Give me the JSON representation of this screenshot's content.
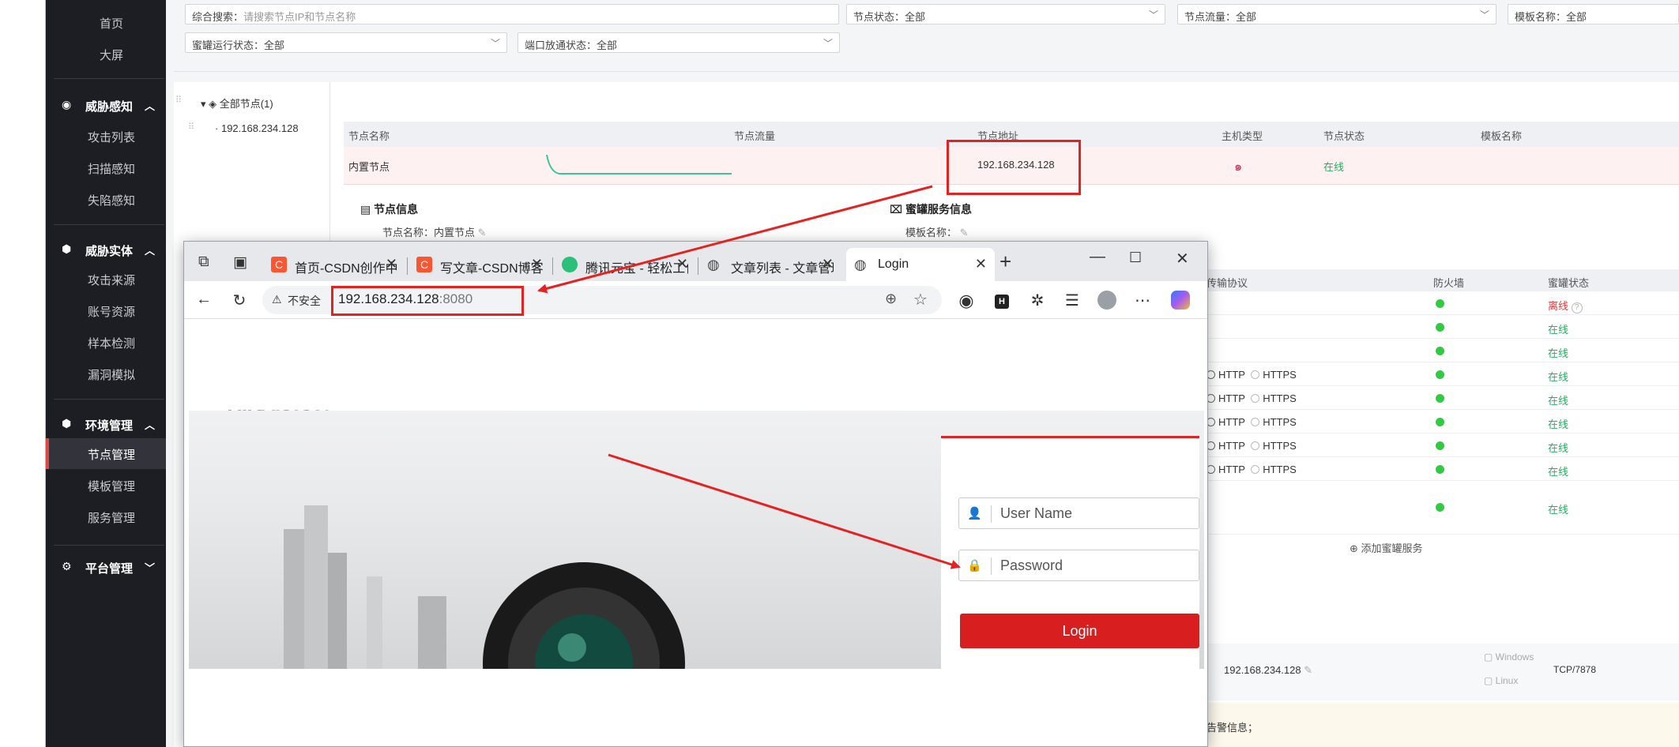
{
  "sidebar": {
    "top_items": [
      "首页",
      "大屏"
    ],
    "groups": [
      {
        "title": "威胁感知",
        "items": [
          "攻击列表",
          "扫描感知",
          "失陷感知"
        ]
      },
      {
        "title": "威胁实体",
        "items": [
          "攻击来源",
          "账号资源",
          "样本检测",
          "漏洞模拟"
        ]
      },
      {
        "title": "环境管理",
        "items": [
          "节点管理",
          "模板管理",
          "服务管理"
        ]
      },
      {
        "title": "平台管理",
        "items": []
      }
    ],
    "active_item": "节点管理"
  },
  "filters": {
    "search_label": "综合搜索：",
    "search_placeholder": "请搜索节点IP和节点名称",
    "node_status": "节点状态：全部",
    "node_traffic": "节点流量：全部",
    "template_name": "模板名称：全部",
    "honeypot_status": "蜜罐运行状态：全部",
    "port_status": "端口放通状态：全部"
  },
  "tree": {
    "root": "全部节点(1)",
    "child": "192.168.234.128"
  },
  "node_table": {
    "headers": [
      "节点名称",
      "节点流量",
      "节点地址",
      "主机类型",
      "节点状态",
      "模板名称"
    ],
    "row": {
      "name": "内置节点",
      "address": "192.168.234.128",
      "status": "在线"
    }
  },
  "node_info": {
    "title": "节点信息",
    "name_label": "节点名称：内置节点",
    "service_title": "蜜罐服务信息",
    "template_label": "模板名称："
  },
  "service_table": {
    "headers": [
      "传输协议",
      "防火墙",
      "蜜罐状态"
    ],
    "rows": [
      {
        "proto": false,
        "status": "离线",
        "help": "?"
      },
      {
        "proto": false,
        "status": "在线"
      },
      {
        "proto": false,
        "status": "在线"
      },
      {
        "proto": true,
        "status": "在线"
      },
      {
        "proto": true,
        "status": "在线"
      },
      {
        "proto": true,
        "status": "在线"
      },
      {
        "proto": true,
        "status": "在线"
      },
      {
        "proto": true,
        "status": "在线"
      },
      {
        "proto": false,
        "status": "在线"
      }
    ],
    "http": "HTTP",
    "https": "HTTPS",
    "add_service": "添加蜜罐服务"
  },
  "bottom_info": {
    "ip": "192.168.234.128",
    "os_windows": "Windows",
    "os_linux": "Linux",
    "port": "TCP/7878",
    "alert": "告警信息；"
  },
  "browser": {
    "tabs": [
      {
        "title": "首页-CSDN创作中心",
        "favicon": "csdn-icon",
        "color": "#fc5531"
      },
      {
        "title": "写文章-CSDN博客",
        "favicon": "csdn-icon",
        "color": "#fc5531"
      },
      {
        "title": "腾讯元宝 - 轻松工作",
        "favicon": "yuanbao-icon",
        "color": "#2bbf7a"
      },
      {
        "title": "文章列表 - 文章管理",
        "favicon": "globe-icon",
        "color": "#555555"
      },
      {
        "title": "Login",
        "favicon": "globe-icon",
        "color": "#555555"
      }
    ],
    "insecure_label": "不安全",
    "url_host": "192.168.234.128",
    "url_port": ":8080"
  },
  "login_page": {
    "brand_hik": "HIK",
    "brand_vision": "VISION",
    "username_placeholder": "User Name",
    "password_placeholder": "Password",
    "login_button": "Login"
  },
  "colors": {
    "accent_red": "#e42222",
    "online_green": "#27ae60",
    "offline_red": "#e63b3b",
    "login_red": "#d81e1e"
  }
}
